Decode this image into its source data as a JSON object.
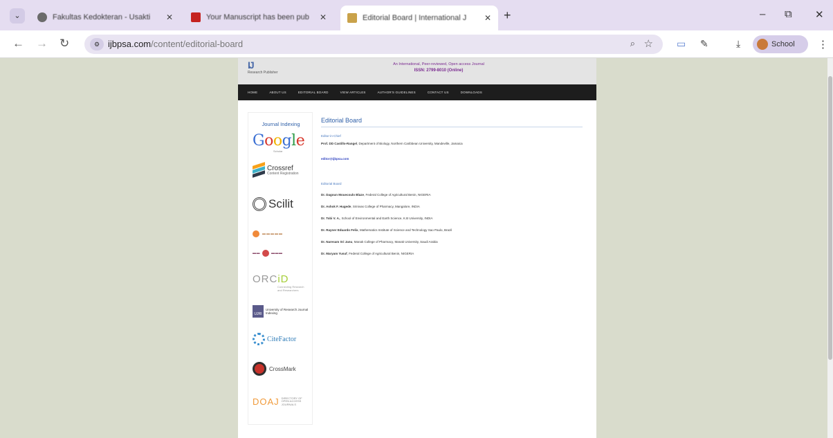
{
  "browser": {
    "tabs": [
      {
        "title": "Fakultas Kedokteran - Usakti",
        "favicon_color": "#6b6b6b"
      },
      {
        "title": "Your Manuscript has been pub",
        "favicon_color": "#c5221f"
      },
      {
        "title": "Editorial Board | International J",
        "favicon_color": "#c9a24a"
      }
    ],
    "new_tab": "+",
    "url_host": "ijbpsa.com",
    "url_path": "/content/editorial-board",
    "profile_label": "School",
    "window": {
      "minimize": "–",
      "restore": "⧉",
      "close": "✕"
    }
  },
  "site": {
    "logo_mark": "IJ",
    "logo_sub": "Research Publisher",
    "tagline": "An International, Peer-reviewed, Open access Journal",
    "issn": "ISSN: 2799-8010 (Online)",
    "nav": [
      "HOME",
      "ABOUT US",
      "EDITORIAL BOARD",
      "VIEW ARTICLES",
      "AUTHOR'S GUIDELINES",
      "CONTACT US",
      "DOWNLOADS"
    ],
    "sidebar": {
      "title": "Journal Indexing",
      "google": "Google",
      "google_sub": "Scholar",
      "crossref": "Crossref",
      "crossref_sub": "Content Registration",
      "scilit": "Scilit",
      "orcid": "ORCID",
      "pm_text": "University of Research Journal Indexing",
      "citefactor": "CiteFactor",
      "crossmark": "CrossMark",
      "doaj": "DOAJ",
      "doaj_sub": "DIRECTORY OF OPEN ACCESS JOURNALS"
    },
    "main": {
      "title": "Editorial Board",
      "editor_label": "Editor-in-Chief",
      "editor_name": "Prof. DD Castillo-Rangel",
      "editor_affil": ", Department of Biology, Northern Caribbean University, Mandeville, Jamaica",
      "email": "editor@ijbpsa.com",
      "board_label": "Editorial Board",
      "members": [
        {
          "name": "Dr. Dagoun Mouecoulo Blaze",
          "affil": ", Federal College of Agricultural Benin, NIGERIA"
        },
        {
          "name": "Dr. Ashok F. Hugede",
          "affil": ", Srinivas College of Pharmacy, Mangalore, INDIA"
        },
        {
          "name": "Dr. Tobi V. A.",
          "affil": ", School of Environmental and Earth Science, K.B University, INDIA"
        },
        {
          "name": "Dr. Rayner Eduardo Felix",
          "affil": ", Mathematics Institute of Science and Technology Sao Paulo, Brazil"
        },
        {
          "name": "Dr. Naresam Sri Janu",
          "affil": ", Manak College of Pharmacy, Manak University, Saudi Arabia"
        },
        {
          "name": "Dr. Maryam Yusuf",
          "affil": ", Federal College of Agricultural Benin, NIGERIA"
        }
      ]
    }
  }
}
